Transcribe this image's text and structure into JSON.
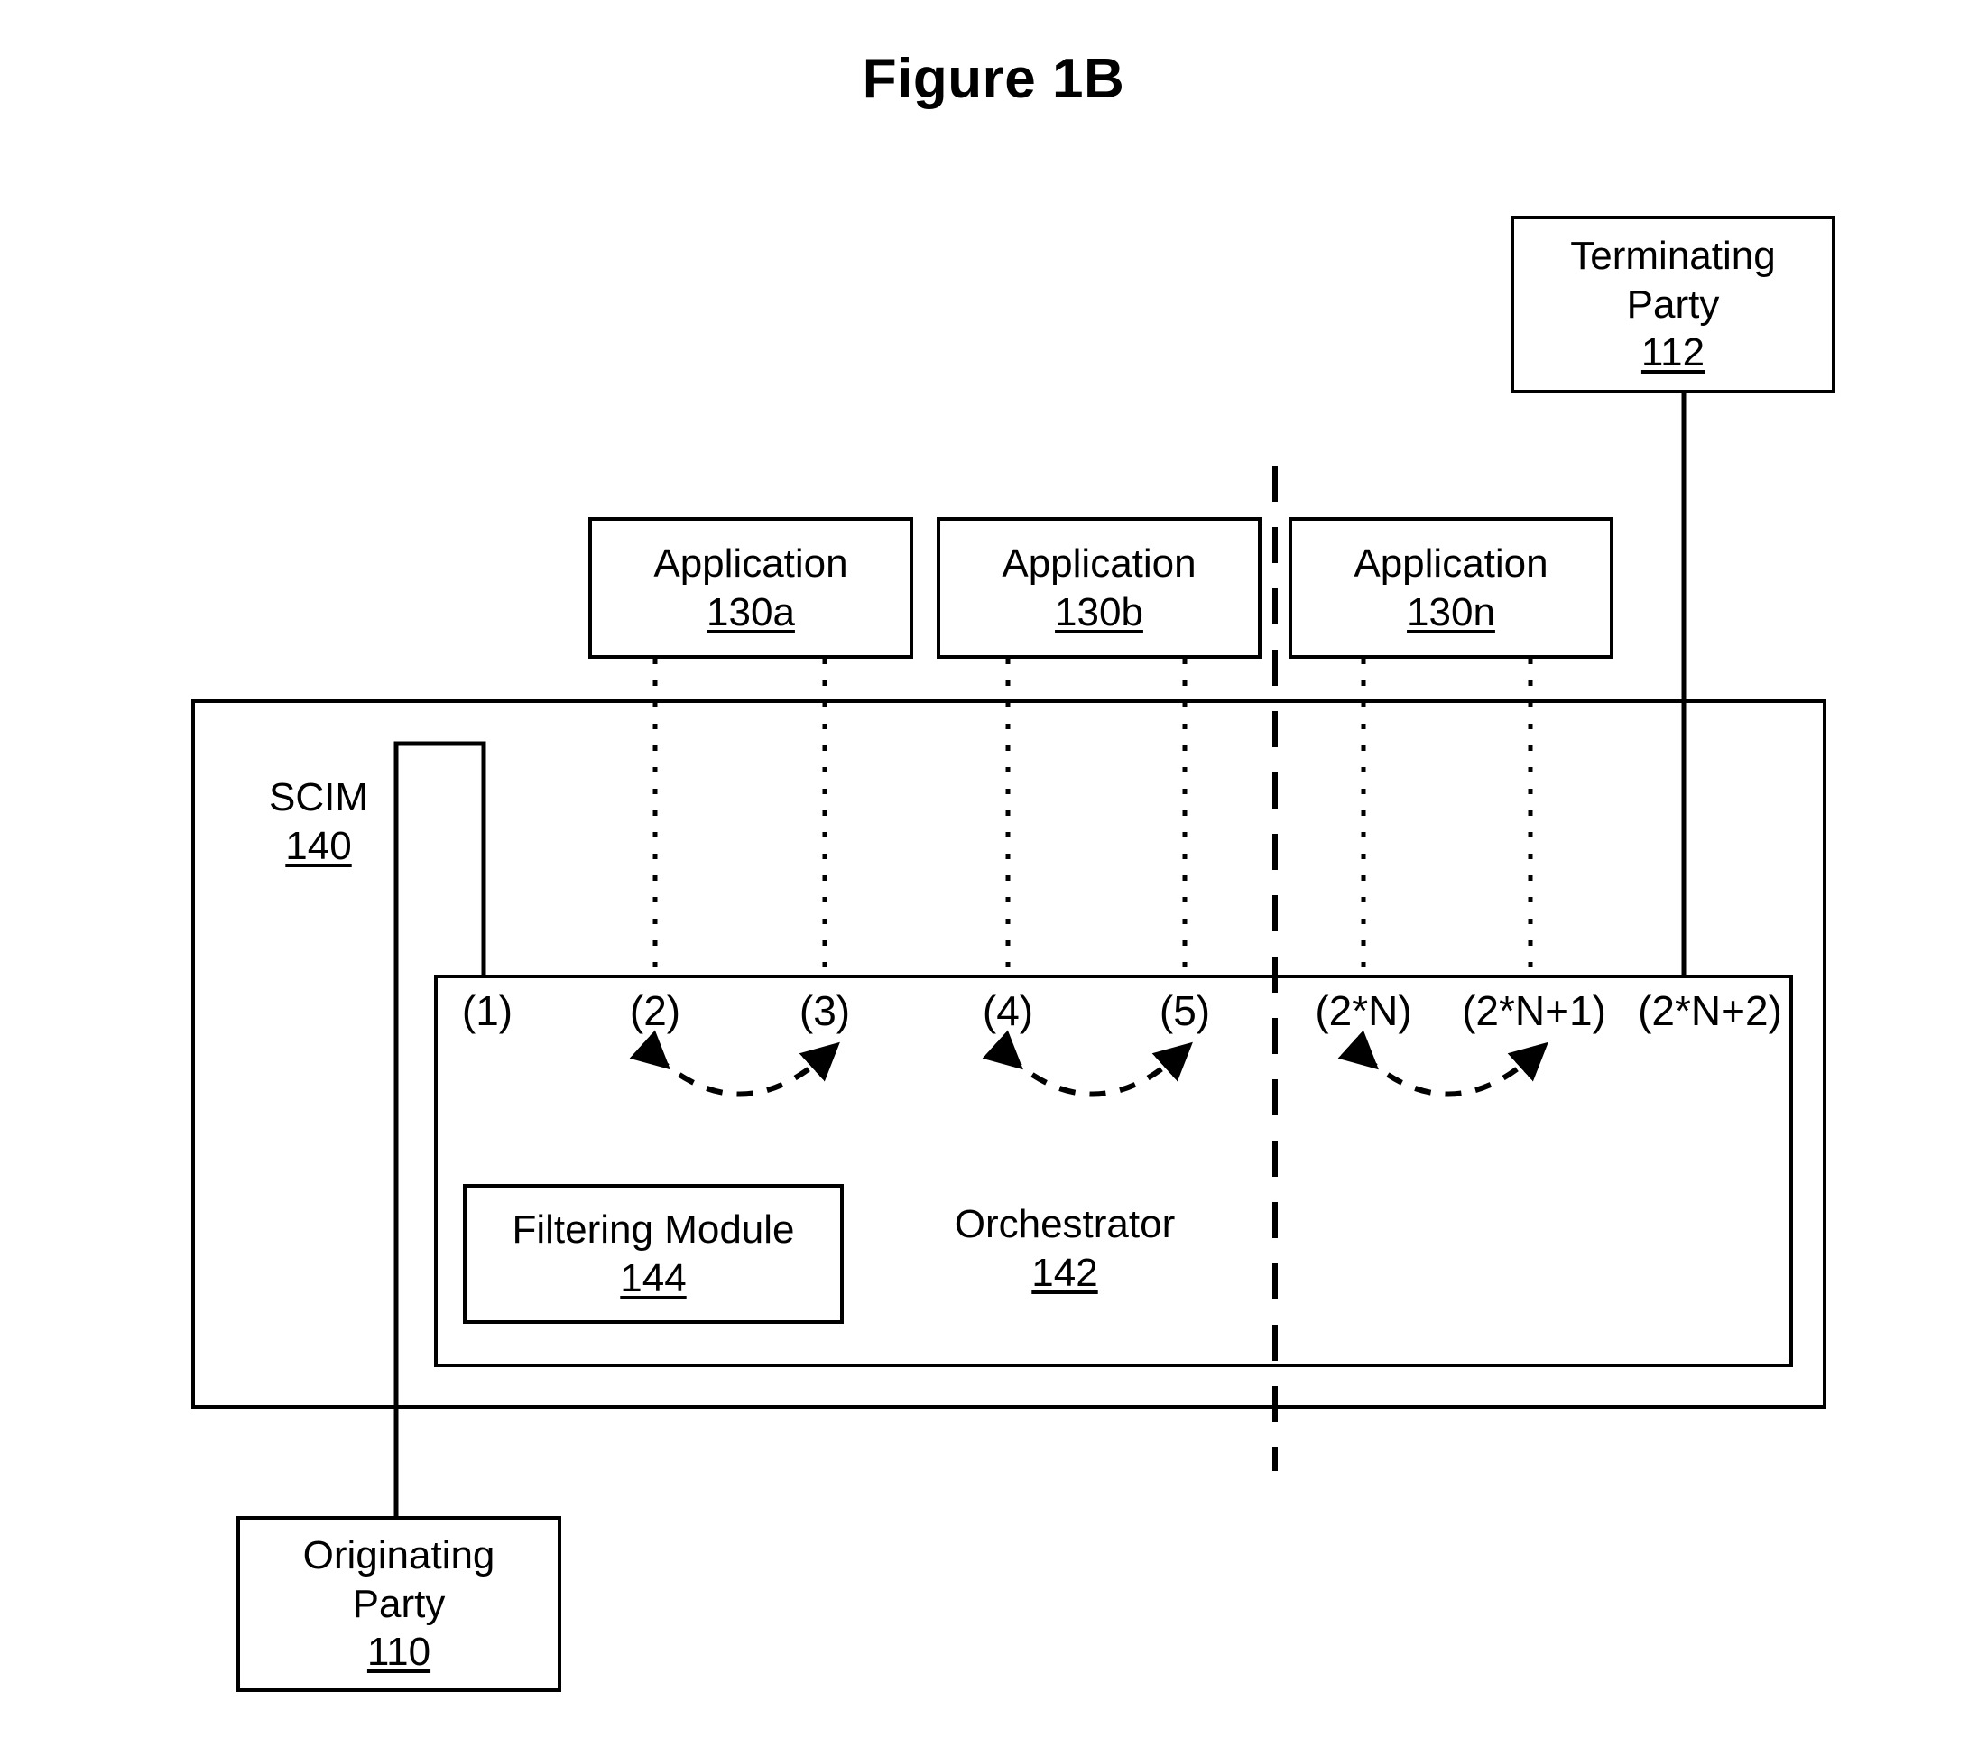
{
  "figure": {
    "title": "Figure 1B"
  },
  "nodes": {
    "terminating_party": {
      "label": "Terminating",
      "label2": "Party",
      "num": "112"
    },
    "originating_party": {
      "label": "Originating",
      "label2": "Party",
      "num": "110"
    },
    "application_a": {
      "label": "Application",
      "num": "130a"
    },
    "application_b": {
      "label": "Application",
      "num": "130b"
    },
    "application_n": {
      "label": "Application",
      "num": "130n"
    },
    "scim": {
      "label": "SCIM",
      "num": "140"
    },
    "orchestrator": {
      "label": "Orchestrator",
      "num": "142"
    },
    "filtering_module": {
      "label": "Filtering Module",
      "num": "144"
    }
  },
  "steps": [
    {
      "id": "step-1",
      "label": "(1)"
    },
    {
      "id": "step-2",
      "label": "(2)"
    },
    {
      "id": "step-3",
      "label": "(3)"
    },
    {
      "id": "step-4",
      "label": "(4)"
    },
    {
      "id": "step-5",
      "label": "(5)"
    },
    {
      "id": "step-2n",
      "label": "(2*N)"
    },
    {
      "id": "step-2n1",
      "label": "(2*N+1)"
    },
    {
      "id": "step-2n2",
      "label": "(2*N+2)"
    }
  ],
  "colors": {
    "stroke": "#000000",
    "background": "#ffffff"
  }
}
